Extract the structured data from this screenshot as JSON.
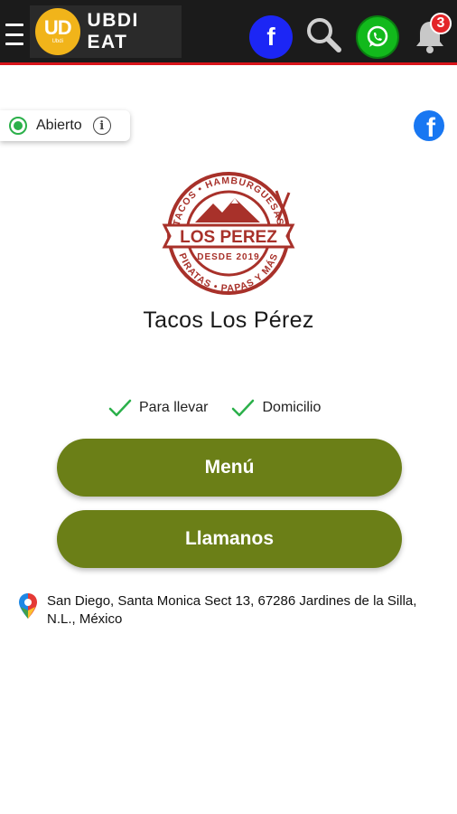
{
  "header": {
    "brand_logo_text": "UD",
    "brand_logo_sub": "Ubdi",
    "brand_name": "UBDI EAT",
    "facebook_label": "f",
    "notification_count": "3"
  },
  "status": {
    "label": "Abierto",
    "info_glyph": "i",
    "color": "#2bb04a"
  },
  "side_facebook_label": "f",
  "restaurant": {
    "logo_top_text": "TACOS • HAMBURGUESAS",
    "logo_banner": "LOS PEREZ",
    "logo_since": "DESDE 2019",
    "logo_bottom_text": "PIRATAS • PAPAS Y MÁS",
    "name": "Tacos Los Pérez"
  },
  "options": [
    {
      "label": "Para llevar"
    },
    {
      "label": "Domicilio"
    }
  ],
  "buttons": {
    "menu": "Menú",
    "call": "Llamanos"
  },
  "address": "San Diego, Santa Monica Sect 13, 67286 Jardines de la Silla, N.L., México",
  "colors": {
    "header_bg": "#1b1b1b",
    "header_border": "#d8141a",
    "accent_green": "#6b7f17",
    "facebook_blue": "#1c26f5",
    "whatsapp_green": "#12b91c",
    "logo_red": "#a8312a"
  },
  "icons": {
    "menu": "hamburger-menu-icon",
    "facebook": "facebook-icon",
    "search": "search-icon",
    "whatsapp": "whatsapp-icon",
    "bell": "bell-icon",
    "info": "info-icon",
    "check": "check-icon",
    "location": "map-pin-icon"
  }
}
